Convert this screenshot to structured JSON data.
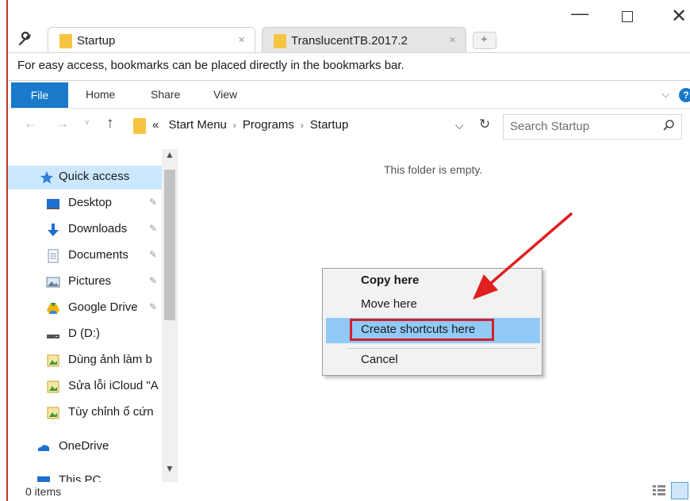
{
  "browser": {
    "tabs": [
      {
        "label": "Startup",
        "close": "×"
      },
      {
        "label": "TranslucentTB.2017.2",
        "close": "×"
      }
    ],
    "window_controls": {
      "minimize": "—",
      "close": "✕"
    },
    "bookmarks_hint": "For easy access, bookmarks can be placed directly in the bookmarks bar."
  },
  "ribbon": {
    "tabs": [
      "File",
      "Home",
      "Share",
      "View"
    ],
    "help": "?",
    "chevron": "⌵"
  },
  "address_bar": {
    "prefix": "«",
    "crumbs": [
      "Start Menu",
      "Programs",
      "Startup"
    ],
    "separator": "›",
    "dropdown": "⌵",
    "refresh": "↻"
  },
  "search": {
    "placeholder": "Search Startup"
  },
  "nav_pane": {
    "items": [
      {
        "label": "Quick access",
        "icon": "star-icon",
        "pinned": false
      },
      {
        "label": "Desktop",
        "icon": "desktop-icon",
        "pinned": true
      },
      {
        "label": "Downloads",
        "icon": "download-icon",
        "pinned": true
      },
      {
        "label": "Documents",
        "icon": "document-icon",
        "pinned": true
      },
      {
        "label": "Pictures",
        "icon": "pictures-icon",
        "pinned": true
      },
      {
        "label": "Google Drive",
        "icon": "google-drive-icon",
        "pinned": true
      },
      {
        "label": "D (D:)",
        "icon": "drive-icon",
        "pinned": false
      },
      {
        "label": "Dùng ảnh làm b",
        "icon": "image-folder-icon",
        "pinned": false
      },
      {
        "label": "Sửa lỗi iCloud \"A",
        "icon": "image-folder-icon",
        "pinned": false
      },
      {
        "label": "Tùy chỉnh ổ cứn",
        "icon": "image-folder-icon",
        "pinned": false
      },
      {
        "label": "OneDrive",
        "icon": "onedrive-icon",
        "pinned": false
      },
      {
        "label": "This PC",
        "icon": "pc-icon",
        "pinned": false
      }
    ]
  },
  "content": {
    "empty_message": "This folder is empty."
  },
  "context_menu": {
    "items": [
      "Copy here",
      "Move here",
      "Create shortcuts here",
      "Cancel"
    ],
    "highlighted": "Create shortcuts here"
  },
  "status_bar": {
    "items": "0 items"
  },
  "colors": {
    "accent_blue": "#1979ca",
    "highlight": "#91c9f7",
    "annotation_red": "#d3202a",
    "folder_yellow": "#f5c542"
  }
}
